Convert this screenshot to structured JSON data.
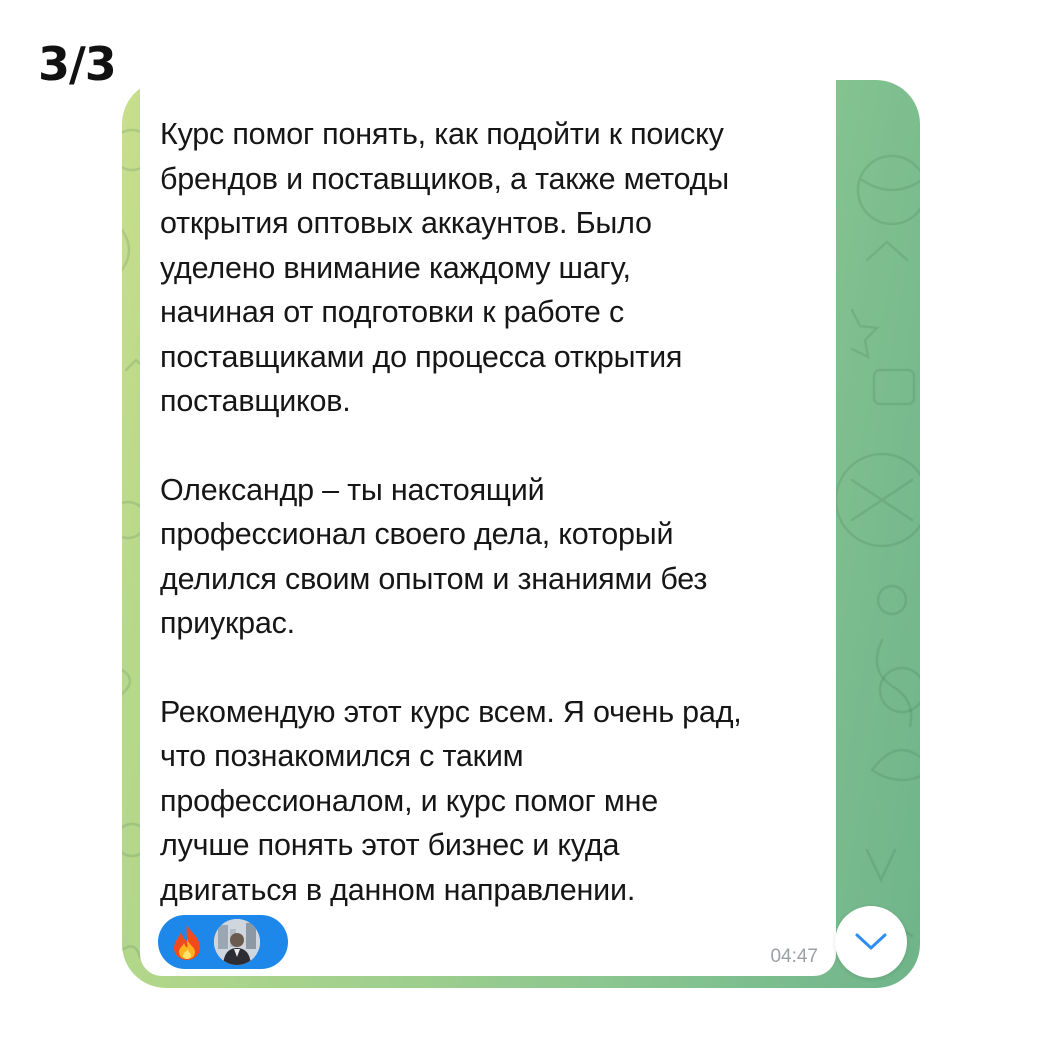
{
  "header": {
    "counter": "3/3"
  },
  "message": {
    "paragraphs": [
      "Курс помог понять, как подойти к поиску\nбрендов и поставщиков, а также методы\nоткрытия оптовых аккаунтов. Было\nуделено внимание каждому шагу,\nначиная от подготовки к работе с\nпоставщиками до процесса открытия\nпоставщиков.",
      "Олександр –  ты настоящий\nпрофессионал своего дела, который\nделился своим опытом и знаниями без\nприукрас.",
      "Рекомендую этот курс всем. Я очень рад,\nчто познакомился с таким\nпрофессионалом, и курс помог мне\nлучше понять этот бизнес и куда\nдвигаться в данном направлении."
    ],
    "time": "04:47",
    "reaction": {
      "emoji": "fire-icon",
      "reactor": "avatar"
    }
  },
  "colors": {
    "background_green": "#84c290",
    "reaction_blue": "#1e88ea",
    "accent_blue": "#2f8ef0"
  },
  "controls": {
    "scroll_down": "chevron-down-icon"
  }
}
